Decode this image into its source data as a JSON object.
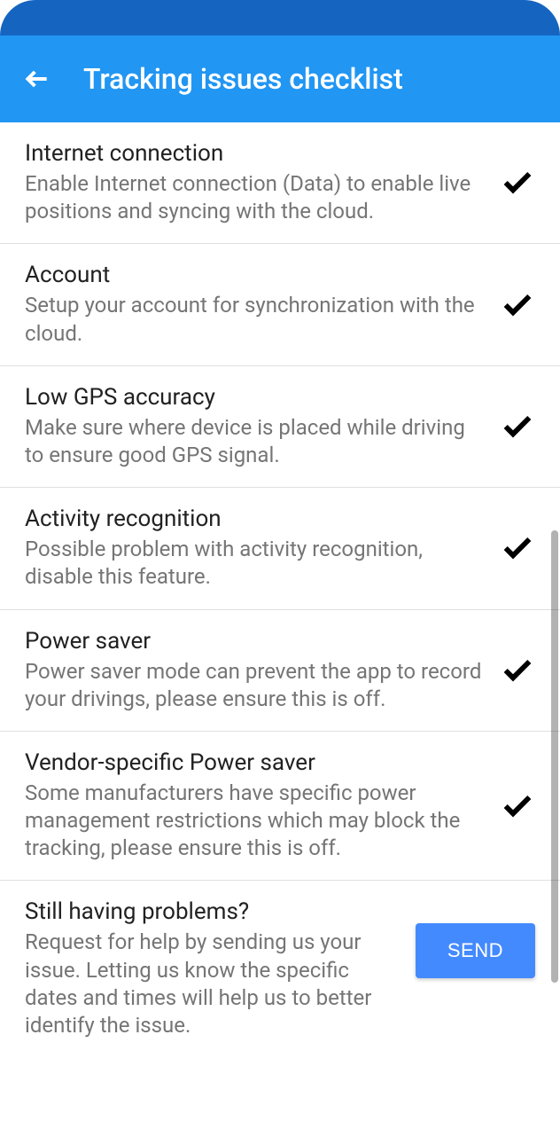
{
  "header": {
    "title": "Tracking issues checklist"
  },
  "checklist": [
    {
      "title": "Internet connection",
      "description": "Enable Internet connection (Data) to enable live positions and syncing with the cloud."
    },
    {
      "title": "Account",
      "description": "Setup your account for synchronization with the cloud."
    },
    {
      "title": "Low GPS accuracy",
      "description": "Make sure where device is placed while driving to ensure good GPS signal."
    },
    {
      "title": "Activity recognition",
      "description": "Possible problem with activity recognition, disable this feature."
    },
    {
      "title": "Power saver",
      "description": "Power saver mode can prevent the app to record your drivings, please ensure this is off."
    },
    {
      "title": "Vendor-specific Power saver",
      "description": "Some manufacturers have specific power management restrictions which may block the tracking, please ensure this is off."
    }
  ],
  "help": {
    "title": "Still having problems?",
    "description": "Request for help by sending us your issue. Letting us know the specific dates and times will help us to better identify the issue.",
    "button_label": "SEND"
  }
}
